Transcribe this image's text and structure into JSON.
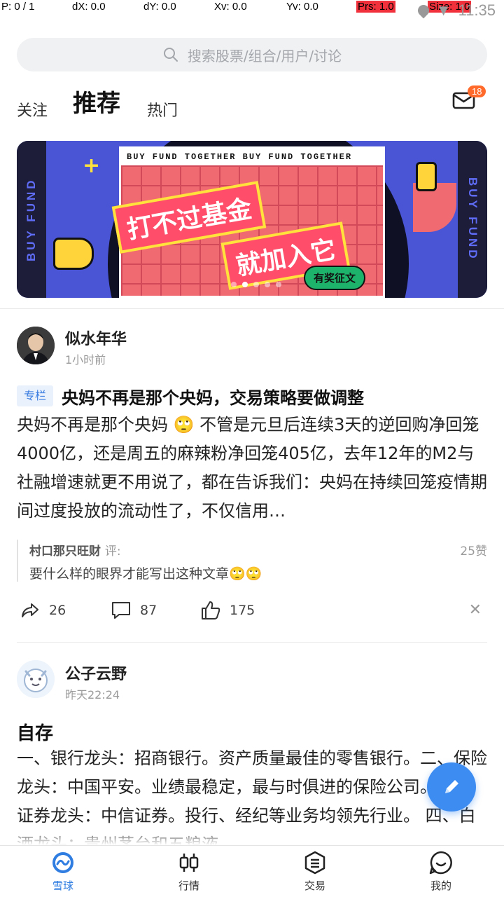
{
  "debug": {
    "p": "P: 0 / 1",
    "dx": "dX: 0.0",
    "dy": "dY: 0.0",
    "xv": "Xv: 0.0",
    "yv": "Yv: 0.0",
    "prs": "Prs: 1.0",
    "size": "Size: 1.0",
    "clock": "11:35"
  },
  "search": {
    "placeholder": "搜索股票/组合/用户/讨论"
  },
  "tabs": {
    "follow": "关注",
    "recommend": "推荐",
    "hot": "热门"
  },
  "mail": {
    "badge": "18"
  },
  "banner": {
    "top_text": "BUY FUND TOGETHER BUY FUND TOGETHER",
    "side_text": "BUY FUND",
    "title_line1": "打不过基金",
    "title_line2": "就加入它",
    "pill": "有奖征文",
    "slides": 5,
    "active_slide": 2
  },
  "post1": {
    "author": "似水年华",
    "time": "1小时前",
    "tag": "专栏",
    "title": "央妈不再是那个央妈，交易策略要做调整",
    "body": "央妈不再是那个央妈 🙄 不管是元旦后连续3天的逆回购净回笼4000亿，还是周五的麻辣粉净回笼405亿，去年12年的M2与社融增速就更不用说了，都在告诉我们：央妈在持续回笼疫情期间过度投放的流动性了，不仅信用…",
    "comment": {
      "user": "村口那只旺财",
      "suffix": "评:",
      "likes": "25赞",
      "text": "要什么样的眼界才能写出这种文章🙄🙄"
    },
    "shares": "26",
    "comments": "87",
    "likes": "175"
  },
  "post2": {
    "author": "公子云野",
    "time": "昨天22:24",
    "title": "自存",
    "body": "一、银行龙头：招商银行。资产质量最佳的零售银行。二、保险龙头：中国平安。业绩最稳定，最与时俱进的保险公司。 三、证券龙头：中信证券。投行、经纪等业务均领先行业。 四、白酒龙头：贵州茅台和五粮液。"
  },
  "nav": {
    "items": [
      {
        "label": "雪球",
        "active": true
      },
      {
        "label": "行情",
        "active": false
      },
      {
        "label": "交易",
        "active": false
      },
      {
        "label": "我的",
        "active": false
      }
    ]
  },
  "colors": {
    "accent": "#2f7de1",
    "fab": "#3d8cf2",
    "badge": "#ff6a2b",
    "tag_bg": "#e9f1fd"
  }
}
